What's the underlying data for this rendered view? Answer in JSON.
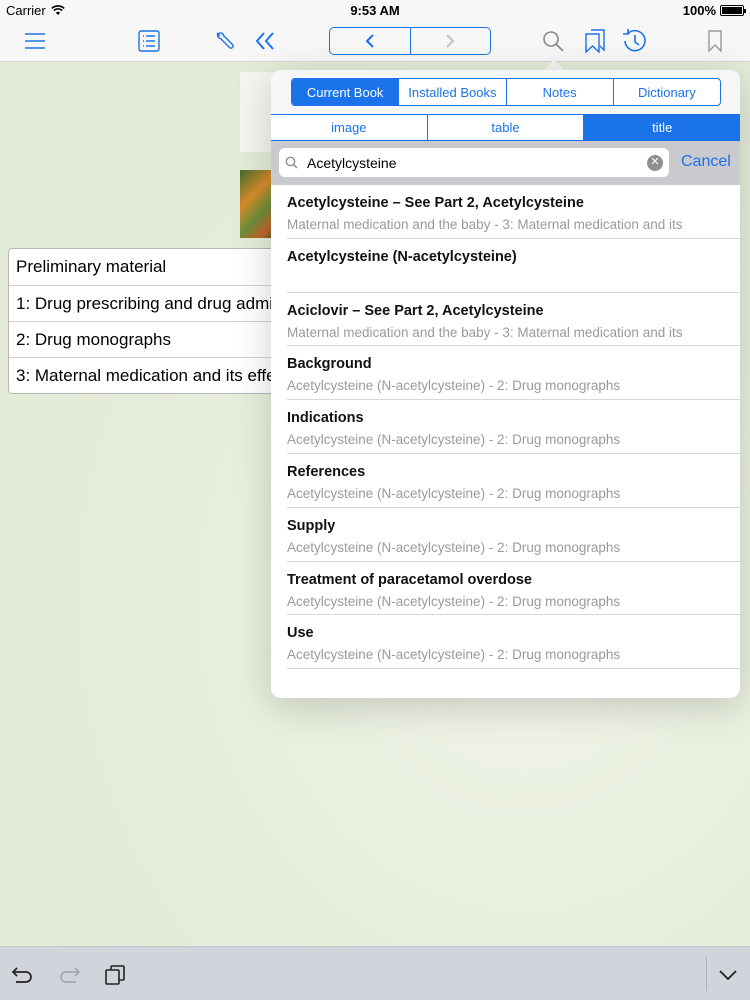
{
  "status_bar": {
    "carrier": "Carrier",
    "time": "9:53 AM",
    "battery": "100%"
  },
  "toolbar": {
    "icons": [
      "menu-icon",
      "list-icon",
      "wrench-icon",
      "double-chevron-left-icon",
      "chevron-left-icon",
      "chevron-right-icon",
      "search-icon",
      "bookmarks-icon",
      "history-icon",
      "bookmark-icon"
    ]
  },
  "toc": {
    "items": [
      "Preliminary material",
      "1: Drug prescribing and drug administration",
      "2: Drug monographs",
      "3: Maternal medication and its effects"
    ]
  },
  "search_popover": {
    "scope_tabs": [
      "Current Book",
      "Installed Books",
      "Notes",
      "Dictionary"
    ],
    "active_scope": "Current Book",
    "type_tabs": [
      "image",
      "table",
      "title"
    ],
    "active_type": "title",
    "query": "Acetylcysteine",
    "cancel_label": "Cancel",
    "results": [
      {
        "title": "Acetylcysteine – See Part 2, Acetylcysteine",
        "subtitle": "Maternal medication and the baby - 3: Maternal medication and its"
      },
      {
        "title": "Acetylcysteine (N-acetylcysteine)",
        "subtitle": ""
      },
      {
        "title": "Aciclovir – See Part 2, Acetylcysteine",
        "subtitle": "Maternal medication and the baby - 3: Maternal medication and its"
      },
      {
        "title": "Background",
        "subtitle": "Acetylcysteine (N-acetylcysteine) - 2: Drug monographs"
      },
      {
        "title": "Indications",
        "subtitle": "Acetylcysteine (N-acetylcysteine) - 2: Drug monographs"
      },
      {
        "title": "References",
        "subtitle": "Acetylcysteine (N-acetylcysteine) - 2: Drug monographs"
      },
      {
        "title": "Supply",
        "subtitle": "Acetylcysteine (N-acetylcysteine) - 2: Drug monographs"
      },
      {
        "title": "Treatment of paracetamol overdose",
        "subtitle": "Acetylcysteine (N-acetylcysteine) - 2: Drug monographs"
      },
      {
        "title": "Use",
        "subtitle": "Acetylcysteine (N-acetylcysteine) - 2: Drug monographs"
      }
    ]
  },
  "bottom_bar": {
    "icons": [
      "undo-icon",
      "redo-icon",
      "copy-icon",
      "chevron-down-icon"
    ]
  },
  "colors": {
    "accent": "#1a73e8",
    "background": "#e3ecd8"
  }
}
